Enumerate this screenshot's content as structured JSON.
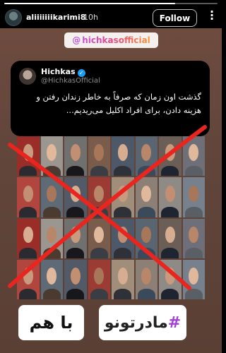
{
  "story": {
    "progress": 0.8,
    "username": "aliiiiiiikarimi8",
    "time": "10h",
    "follow_label": "Follow",
    "more_icon": "more-icon"
  },
  "mention": {
    "at": "@",
    "handle": "hichkasofficial"
  },
  "tweet": {
    "name": "Hichkas",
    "verified": "✓",
    "handle": "@HichkasOfficial",
    "text": "گذشت اون زمان که صرفاً به خاطر زندان رفتن و هزینه دادن، برای افراد اکلیل می‌ریدیم..."
  },
  "grid": {
    "rows": 4,
    "cols": 8,
    "strike_color": "#e8251f"
  },
  "stickers": {
    "left": "با هم",
    "right_hash": "#",
    "right_text": "مادرتونو"
  },
  "colors": {
    "story_bg": "#62463c",
    "hashtag": "#a23fd6",
    "verified": "#1d9bf0"
  }
}
